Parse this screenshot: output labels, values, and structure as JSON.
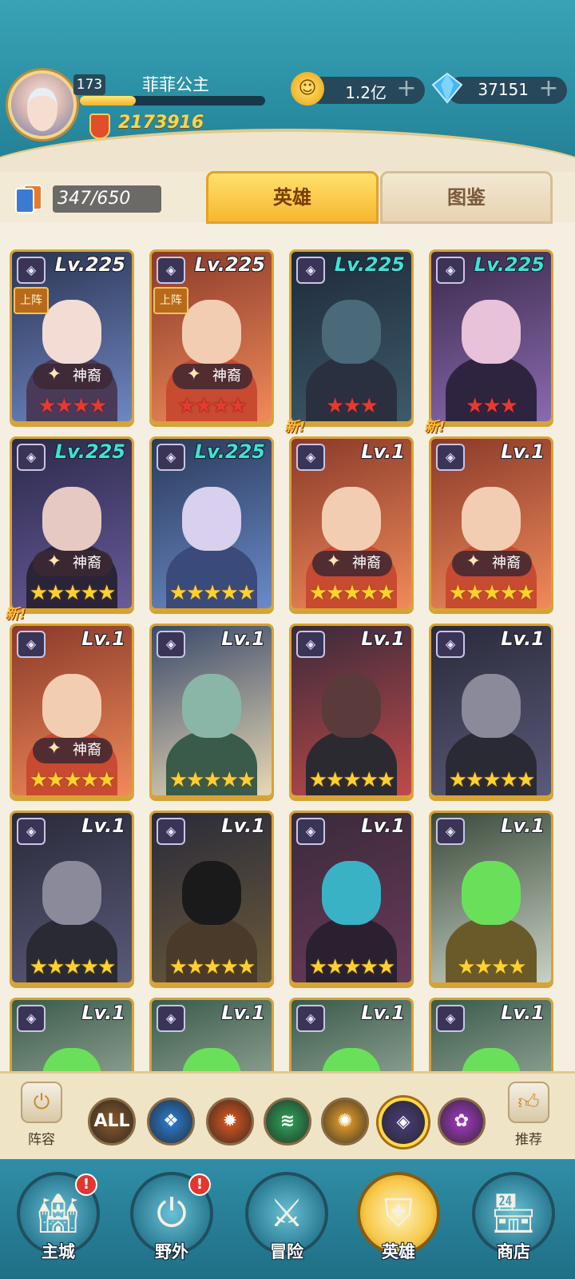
{
  "player": {
    "level": "173",
    "name": "菲菲公主",
    "exp_progress": 0.3,
    "power": "2173916"
  },
  "resources": {
    "gold": "1.2亿",
    "diamonds": "37151",
    "plus": "+"
  },
  "collection": {
    "count": "347/650"
  },
  "tabs": [
    {
      "label": "英雄"
    },
    {
      "label": "图鉴"
    }
  ],
  "heroes": [
    {
      "level": "Lv.225",
      "on_team": "上阵",
      "tag": "神裔",
      "stars": "★★★★",
      "star_color": "red"
    },
    {
      "level": "Lv.225",
      "on_team": "上阵",
      "tag": "神裔",
      "stars": "★★★★",
      "star_color": "red"
    },
    {
      "level": "Lv.225",
      "stars": "★★★",
      "star_color": "red"
    },
    {
      "level": "Lv.225",
      "stars": "★★★",
      "star_color": "red"
    },
    {
      "level": "Lv.225",
      "tag": "神裔",
      "stars": "★★★★★",
      "star_color": "gold"
    },
    {
      "level": "Lv.225",
      "stars": "★★★★★",
      "star_color": "gold"
    },
    {
      "level": "Lv.1",
      "new": "新!",
      "tag": "神裔",
      "stars": "★★★★★",
      "star_color": "gold"
    },
    {
      "level": "Lv.1",
      "new": "新!",
      "tag": "神裔",
      "stars": "★★★★★",
      "star_color": "gold"
    },
    {
      "level": "Lv.1",
      "new": "新!",
      "tag": "神裔",
      "stars": "★★★★★",
      "star_color": "gold"
    },
    {
      "level": "Lv.1",
      "stars": "★★★★★",
      "star_color": "gold"
    },
    {
      "level": "Lv.1",
      "stars": "★★★★★",
      "star_color": "gold"
    },
    {
      "level": "Lv.1",
      "stars": "★★★★★",
      "star_color": "gold"
    },
    {
      "level": "Lv.1",
      "stars": "★★★★★",
      "star_color": "gold"
    },
    {
      "level": "Lv.1",
      "stars": "★★★★★",
      "star_color": "gold"
    },
    {
      "level": "Lv.1",
      "stars": "★★★★★",
      "star_color": "gold"
    },
    {
      "level": "Lv.1",
      "stars": "★★★★",
      "star_color": "gold"
    },
    {
      "level": "Lv.1"
    },
    {
      "level": "Lv.1"
    },
    {
      "level": "Lv.1"
    },
    {
      "level": "Lv.1"
    }
  ],
  "filter_bar": {
    "lineup_label": "阵容",
    "recommend_label": "推荐",
    "filters": [
      {
        "name": "all",
        "text": "ALL",
        "color": "#8a5a2a"
      },
      {
        "name": "water",
        "text": "",
        "color": "#2a7fd6"
      },
      {
        "name": "fire",
        "text": "",
        "color": "#e0581e"
      },
      {
        "name": "wind",
        "text": "",
        "color": "#2fa75a"
      },
      {
        "name": "light",
        "text": "",
        "color": "#f0a62a"
      },
      {
        "name": "dark",
        "text": "",
        "color": "#4a3e7a",
        "selected": true
      },
      {
        "name": "arcane",
        "text": "",
        "color": "#a63ac6"
      }
    ]
  },
  "nav": [
    {
      "label": "主城",
      "badge": "!"
    },
    {
      "label": "野外",
      "badge": "!"
    },
    {
      "label": "冒险"
    },
    {
      "label": "英雄",
      "active": true
    },
    {
      "label": "商店"
    }
  ]
}
